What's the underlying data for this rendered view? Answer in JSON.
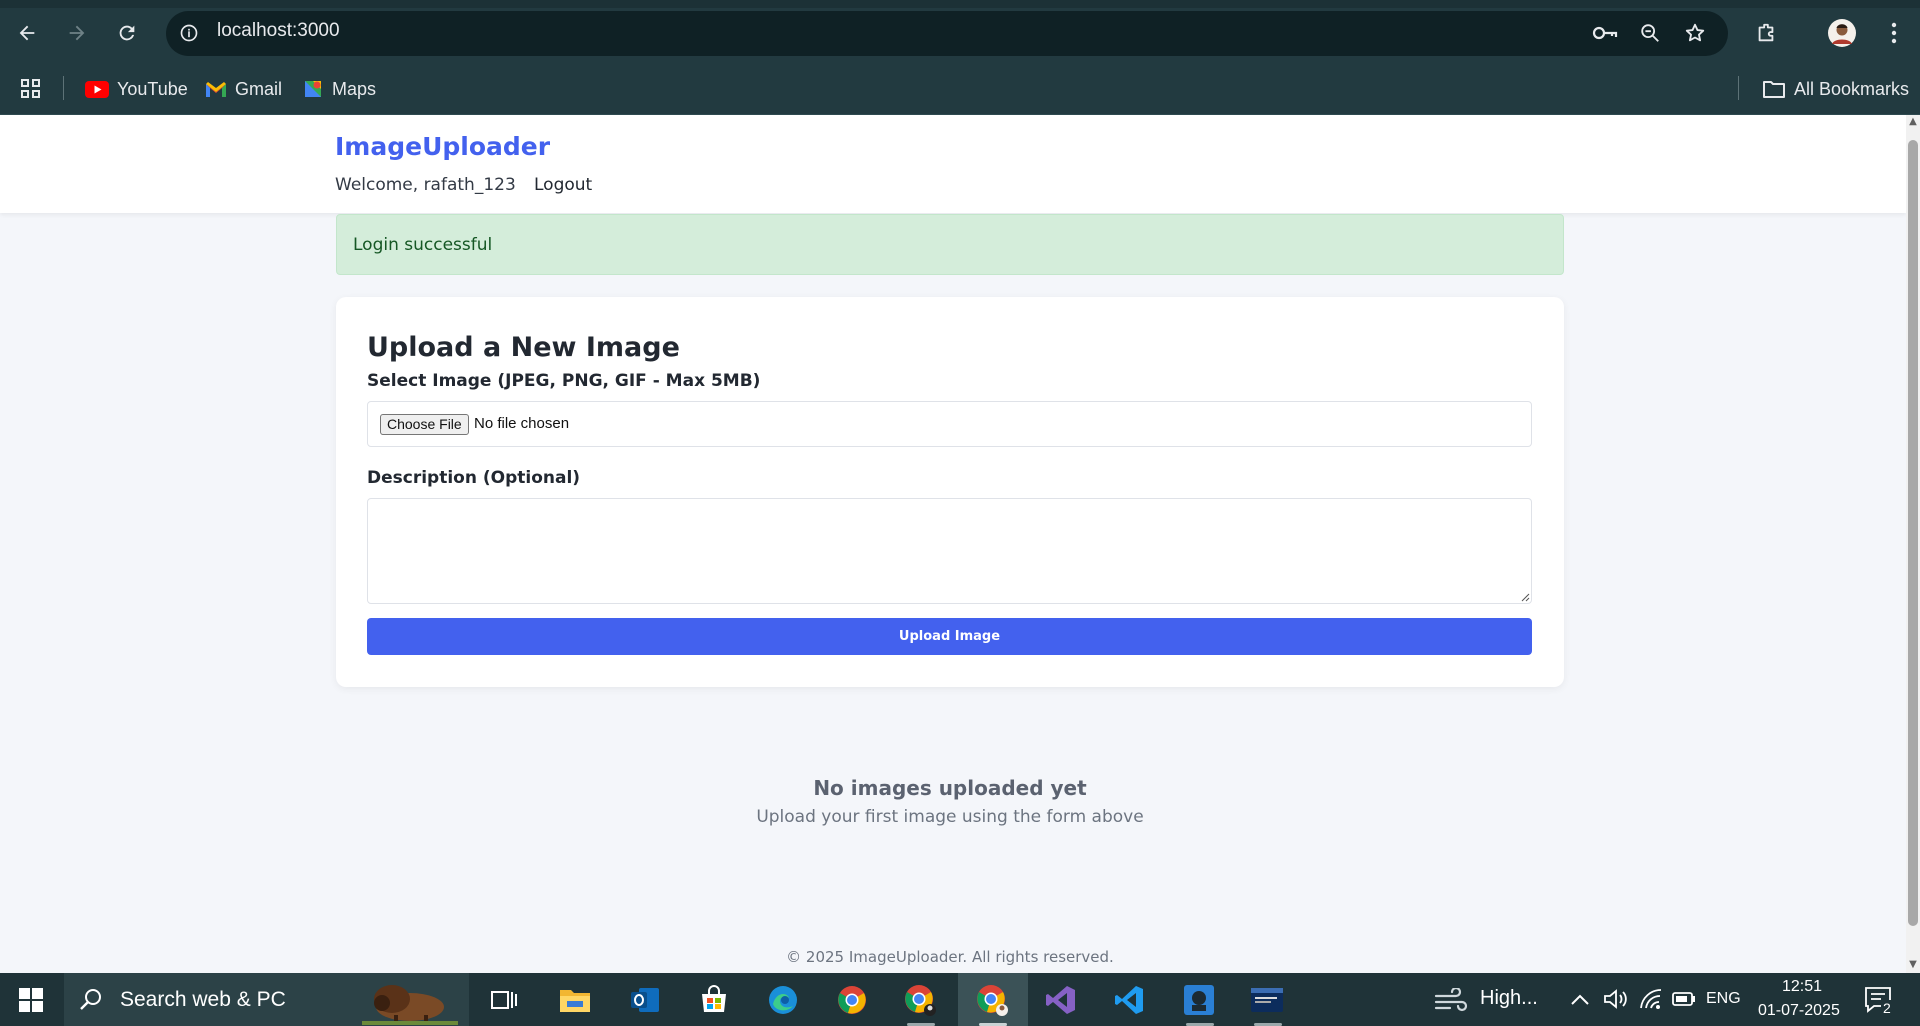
{
  "browser": {
    "url": "localhost:3000",
    "bookmarks": [
      {
        "label": "YouTube",
        "icon": "youtube-icon"
      },
      {
        "label": "Gmail",
        "icon": "gmail-icon"
      },
      {
        "label": "Maps",
        "icon": "maps-icon"
      }
    ],
    "all_bookmarks_label": "All Bookmarks"
  },
  "site": {
    "brand": "ImageUploader",
    "welcome": "Welcome, rafath_123",
    "logout_label": "Logout",
    "accent_color": "#4361ee"
  },
  "alert": {
    "text": "Login successful",
    "type": "success"
  },
  "upload_form": {
    "title": "Upload a New Image",
    "image_label": "Select Image (JPEG, PNG, GIF - Max 5MB)",
    "choose_file_label": "Choose File",
    "file_status": "No file chosen",
    "description_label": "Description (Optional)",
    "description_value": "",
    "submit_label": "Upload Image"
  },
  "empty_state": {
    "title": "No images uploaded yet",
    "subtitle": "Upload your first image using the form above"
  },
  "footer": {
    "text": "© 2025 ImageUploader. All rights reserved."
  },
  "taskbar": {
    "search_placeholder": "Search web & PC",
    "weather": "High...",
    "language": "ENG",
    "time": "12:51",
    "date": "01-07-2025",
    "notification_count": "2",
    "apps": [
      "task-view-icon",
      "file-explorer-icon",
      "outlook-icon",
      "microsoft-store-icon",
      "edge-icon",
      "chrome-icon",
      "chrome-profile-icon",
      "chrome-active-icon",
      "visual-studio-icon",
      "vscode-icon",
      "app-icon",
      "terminal-icon"
    ]
  }
}
